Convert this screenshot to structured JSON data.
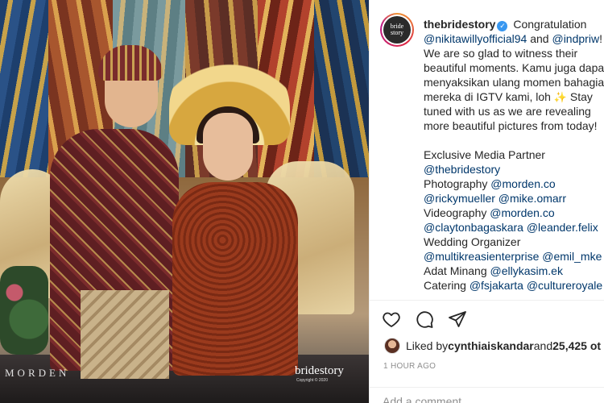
{
  "photo": {
    "watermark_left": "MORDEN",
    "watermark_right": "bridestory",
    "watermark_copyright": "Copyright © 2020"
  },
  "post": {
    "avatar_text": "bride story",
    "username": "thebridestory",
    "verified": true,
    "caption_lines": [
      [
        {
          "t": "text",
          "v": "Congratulation"
        }
      ],
      [
        {
          "t": "mention",
          "v": "@nikitawillyofficial94"
        },
        {
          "t": "text",
          "v": " and "
        },
        {
          "t": "mention",
          "v": "@indpriw"
        },
        {
          "t": "text",
          "v": "!"
        }
      ],
      [
        {
          "t": "text",
          "v": "We are so glad to witness their"
        }
      ],
      [
        {
          "t": "text",
          "v": "beautiful moments. Kamu juga dapa"
        }
      ],
      [
        {
          "t": "text",
          "v": "menyaksikan ulang momen bahagia"
        }
      ],
      [
        {
          "t": "text",
          "v": "mereka di IGTV kami, loh "
        },
        {
          "t": "emoji",
          "v": "✨"
        },
        {
          "t": "text",
          "v": " Stay"
        }
      ],
      [
        {
          "t": "text",
          "v": "tuned with us as we are revealing"
        }
      ],
      [
        {
          "t": "text",
          "v": "more beautiful pictures from today!"
        }
      ],
      [],
      [
        {
          "t": "text",
          "v": "Exclusive Media Partner"
        }
      ],
      [
        {
          "t": "mention",
          "v": "@thebridestory"
        }
      ],
      [
        {
          "t": "text",
          "v": "Photography "
        },
        {
          "t": "mention",
          "v": "@morden.co"
        }
      ],
      [
        {
          "t": "mention",
          "v": "@rickymueller"
        },
        {
          "t": "text",
          "v": " "
        },
        {
          "t": "mention",
          "v": "@mike.omarr"
        }
      ],
      [
        {
          "t": "text",
          "v": "Videography "
        },
        {
          "t": "mention",
          "v": "@morden.co"
        }
      ],
      [
        {
          "t": "mention",
          "v": "@claytonbagaskara"
        },
        {
          "t": "text",
          "v": " "
        },
        {
          "t": "mention",
          "v": "@leander.felix"
        }
      ],
      [
        {
          "t": "text",
          "v": "Wedding Organizer"
        }
      ],
      [
        {
          "t": "mention",
          "v": "@multikreasienterprise"
        },
        {
          "t": "text",
          "v": " "
        },
        {
          "t": "mention",
          "v": "@emil_mke"
        }
      ],
      [
        {
          "t": "text",
          "v": "Adat Minang "
        },
        {
          "t": "mention",
          "v": "@ellykasim.ek"
        }
      ],
      [
        {
          "t": "text",
          "v": "Catering "
        },
        {
          "t": "mention",
          "v": "@fsjakarta"
        },
        {
          "t": "text",
          "v": " "
        },
        {
          "t": "mention",
          "v": "@cultureroyale"
        }
      ]
    ],
    "actions": {
      "like_icon": "heart-icon",
      "comment_icon": "comment-icon",
      "share_icon": "paper-plane-icon"
    },
    "likes": {
      "prefix": "Liked by ",
      "user": "cynthiaiskandar",
      "middle": " and ",
      "others": "25,425 ot"
    },
    "timestamp": "1 HOUR AGO",
    "comment_placeholder": "Add a comment…"
  },
  "colors": {
    "mention": "#00376b",
    "verified": "#3897f0",
    "muted": "#8e8e8e"
  }
}
